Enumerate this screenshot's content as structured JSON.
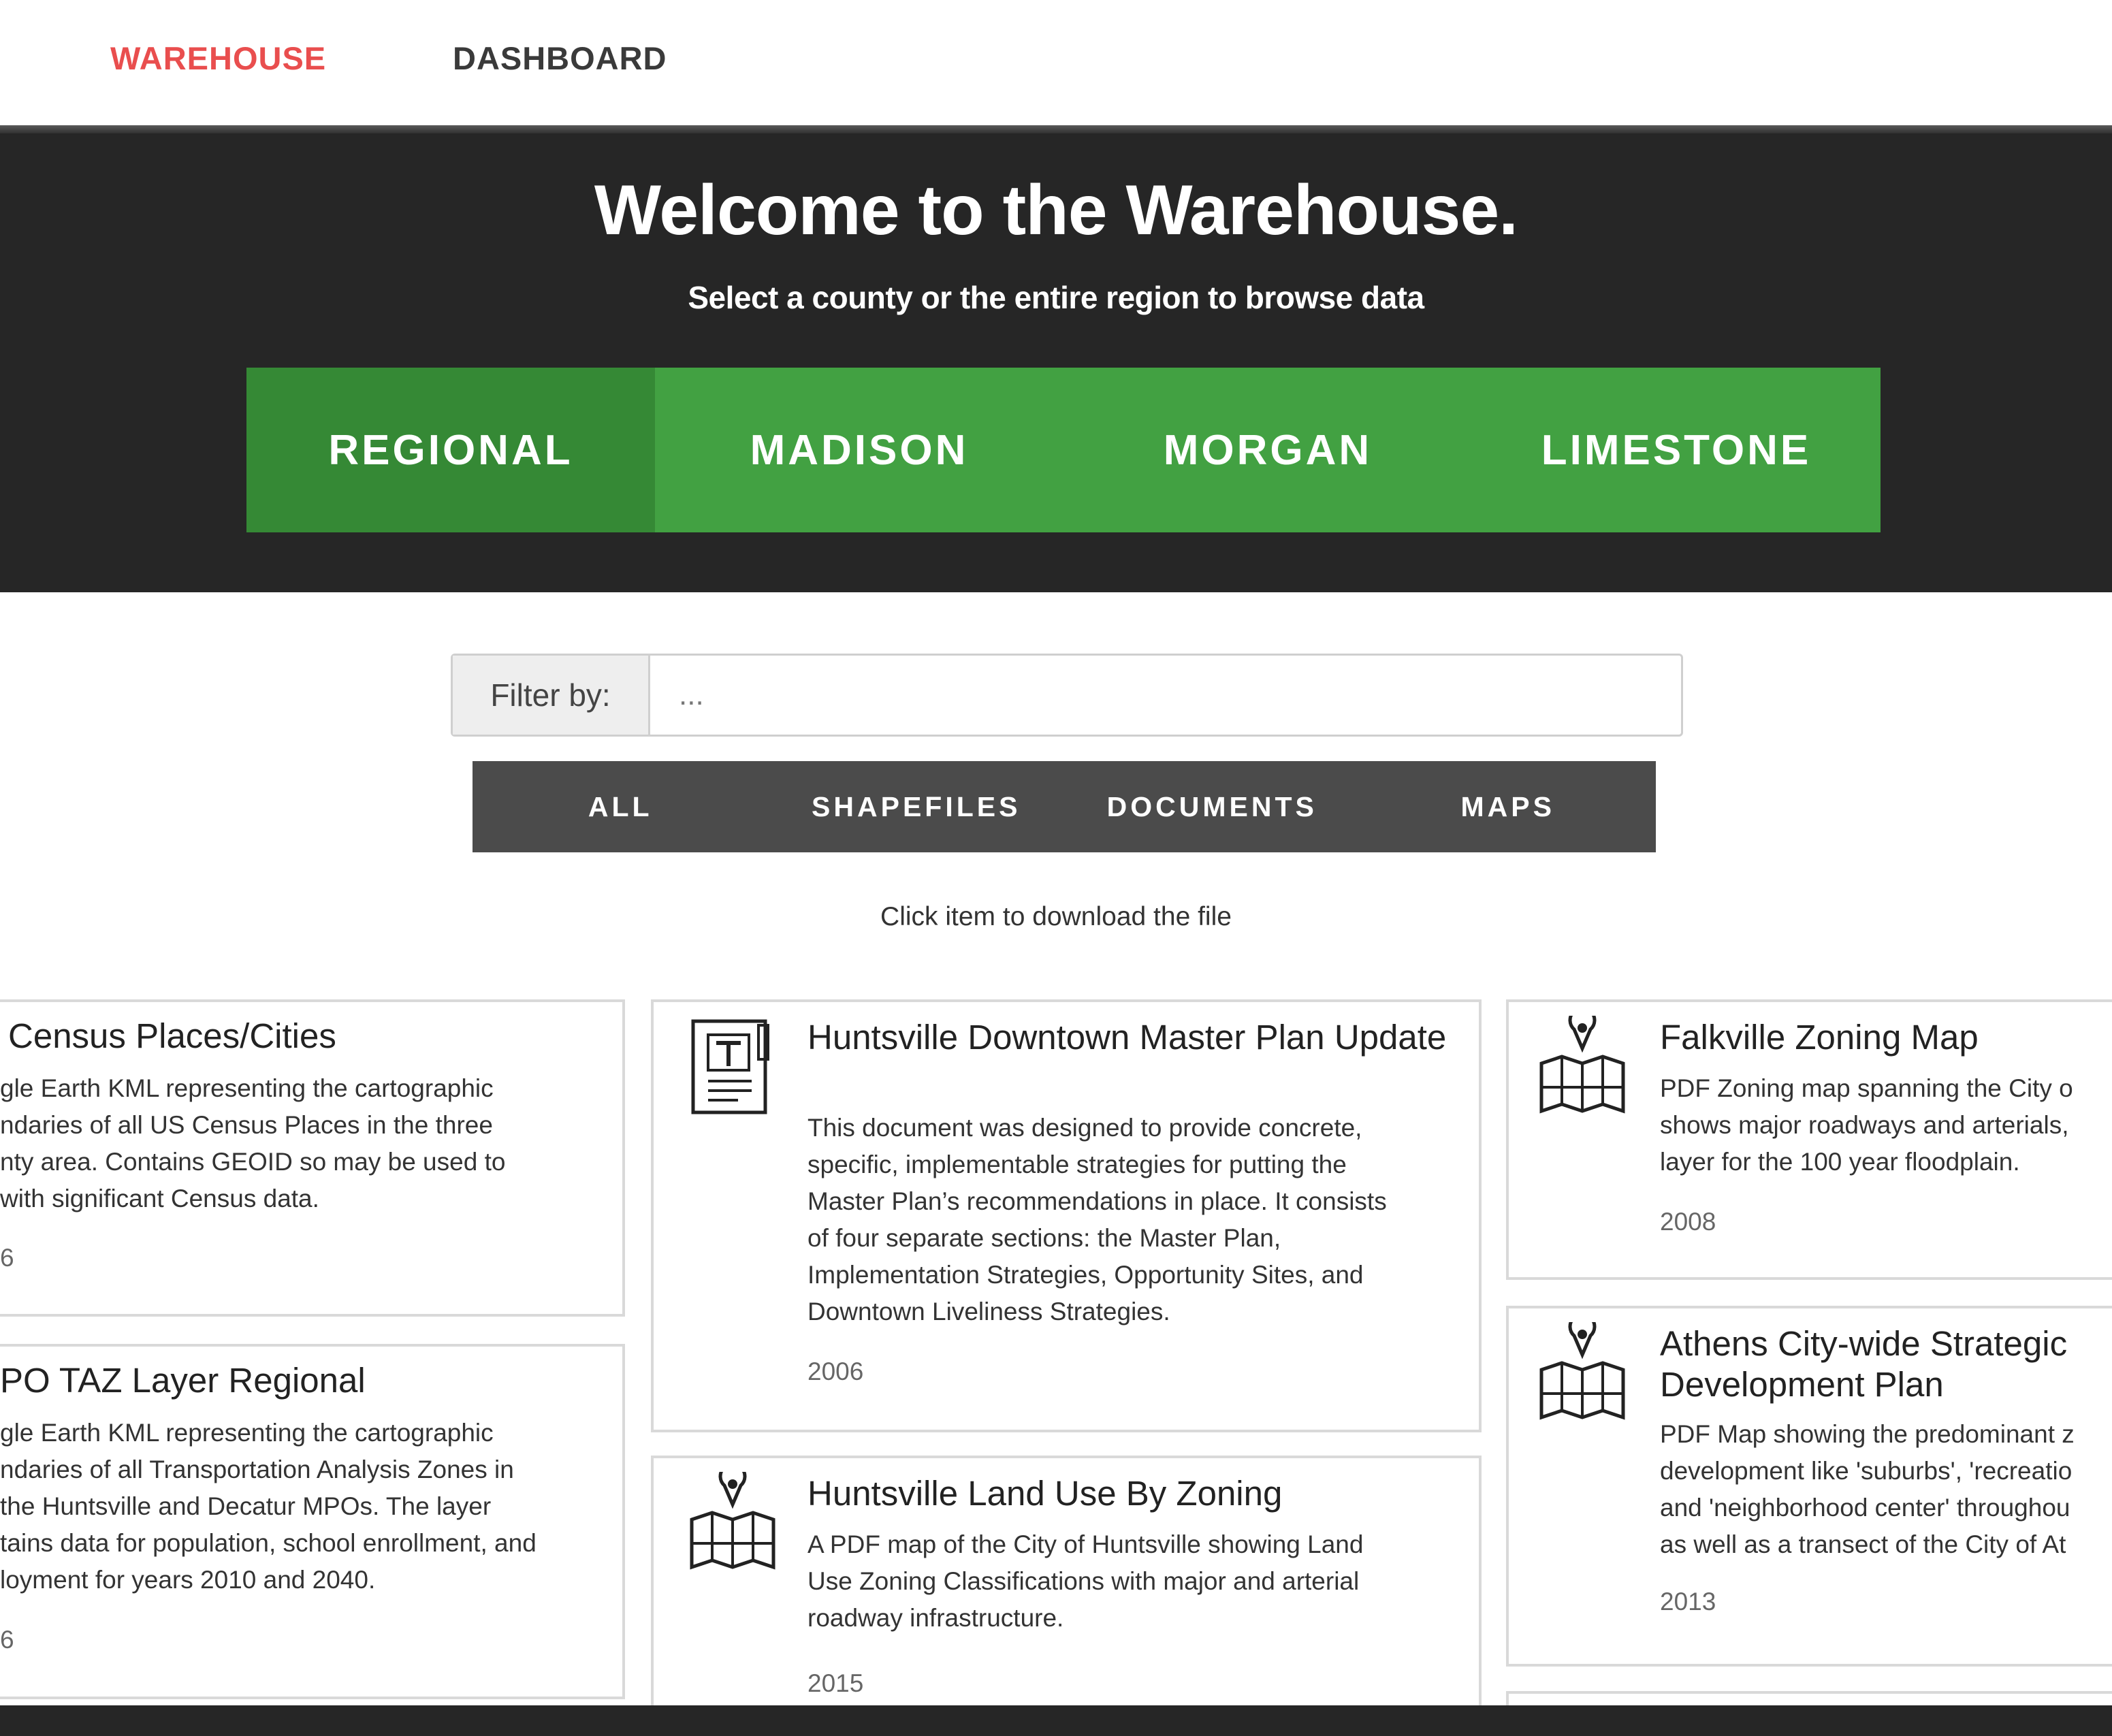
{
  "nav": {
    "warehouse": "WAREHOUSE",
    "dashboard": "DASHBOARD",
    "active_color": "#e94e4e",
    "inactive_color": "#3a3a3a"
  },
  "hero": {
    "title": "Welcome to the Warehouse.",
    "subtitle": "Select a county or the entire region to browse data"
  },
  "counties": [
    {
      "label": "REGIONAL",
      "active": true
    },
    {
      "label": "MADISON",
      "active": false
    },
    {
      "label": "MORGAN",
      "active": false
    },
    {
      "label": "LIMESTONE",
      "active": false
    }
  ],
  "filter": {
    "label": "Filter by:",
    "placeholder": "..."
  },
  "types": [
    "ALL",
    "SHAPEFILES",
    "DOCUMENTS",
    "MAPS"
  ],
  "hint": "Click item to download the file",
  "cards": [
    {
      "title": "Census Places/Cities",
      "desc": [
        "gle Earth KML representing the cartographic",
        "ndaries of all US Census Places in the three",
        "nty area. Contains GEOID so may be used to",
        "with significant Census data."
      ],
      "year": "6",
      "icon": "none"
    },
    {
      "title": "PO TAZ Layer Regional",
      "desc": [
        "gle Earth KML representing the cartographic",
        "ndaries of all Transportation Analysis Zones in",
        "the Huntsville and Decatur MPOs. The layer",
        "tains data for population, school enrollment, and",
        "loyment for years 2010 and 2040."
      ],
      "year": "6",
      "icon": "none"
    },
    {
      "title": "Huntsville Downtown Master Plan Update",
      "desc": [
        "This document was designed to provide concrete,",
        "specific, implementable strategies for putting the",
        "Master Plan’s recommendations in place. It consists",
        "of four separate sections: the Master Plan,",
        "Implementation Strategies, Opportunity Sites, and",
        "Downtown Liveliness Strategies."
      ],
      "year": "2006",
      "icon": "document-icon"
    },
    {
      "title": "Huntsville Land Use By Zoning",
      "desc": [
        "A PDF map of the City of Huntsville showing Land",
        "Use Zoning Classifications with major and arterial",
        "roadway infrastructure."
      ],
      "year": "2015",
      "icon": "map-icon"
    },
    {
      "title": "Falkville Zoning Map",
      "desc": [
        "PDF Zoning map spanning the City o",
        "shows major roadways and arterials,",
        "layer for the 100 year floodplain."
      ],
      "year": "2008",
      "icon": "map-icon"
    },
    {
      "title": "Athens City-wide Strategic Development Plan",
      "desc": [
        "PDF Map showing the predominant z",
        "development like 'suburbs', 'recreatio",
        "and 'neighborhood center' throughou",
        "as well as a transect of the City of At"
      ],
      "year": "2013",
      "icon": "map-icon"
    }
  ]
}
